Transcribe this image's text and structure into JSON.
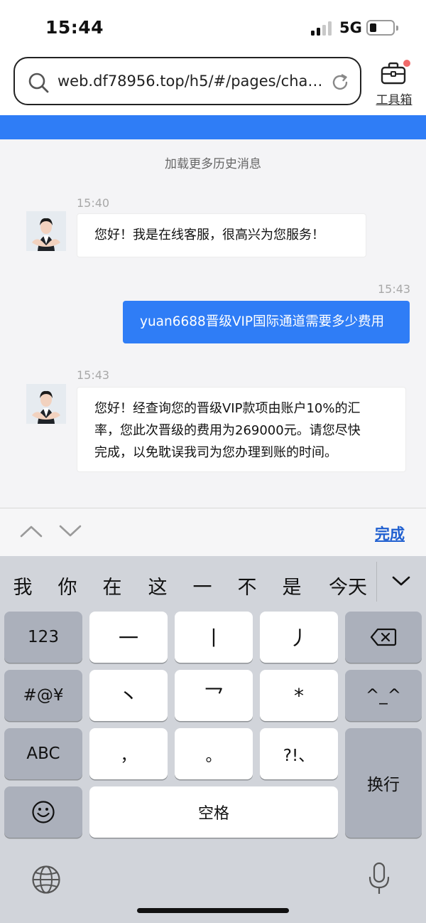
{
  "status_bar": {
    "time": "15:44",
    "network": "5G"
  },
  "browser": {
    "url": "web.df78956.top/h5/#/pages/chat/i...",
    "toolbox_label": "工具箱"
  },
  "chat": {
    "load_more": "加载更多历史消息",
    "messages": [
      {
        "side": "left",
        "time": "15:40",
        "text": "您好！我是在线客服，很高兴为您服务！"
      },
      {
        "side": "right",
        "time": "15:43",
        "text": "yuan6688晋级VIP国际通道需要多少费用"
      },
      {
        "side": "left",
        "time": "15:43",
        "lines": [
          "您好！经查询您的晋级VIP款项由账户10%的汇",
          "率，您此次晋级的费用为269000元。请您尽快",
          "完成，以免耽误我司为您办理到账的时间。"
        ]
      }
    ]
  },
  "accessory": {
    "done_label": "完成"
  },
  "keyboard": {
    "candidates": [
      "我",
      "你",
      "在",
      "这",
      "一",
      "不",
      "是",
      "今天"
    ],
    "keys": {
      "k123": "123",
      "stroke_h": "一",
      "stroke_s": "丨",
      "stroke_p": "丿",
      "symbols": "#@¥",
      "stroke_d": "丶",
      "stroke_z": "乛",
      "star": "*",
      "emoticon": "^_^",
      "abc": "ABC",
      "comma": "，",
      "period": "。",
      "punct": "?!、",
      "space": "空格",
      "return": "换行"
    }
  },
  "colors": {
    "accent": "#2f7df6",
    "chat_bg": "#f4f4f6",
    "keyboard_bg": "#d1d4da"
  }
}
